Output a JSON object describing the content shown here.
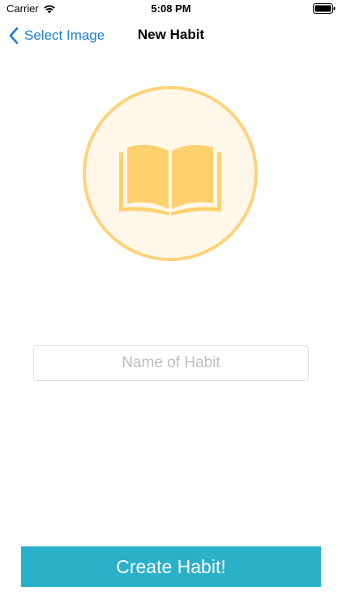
{
  "status_bar": {
    "carrier": "Carrier",
    "time": "5:08 PM",
    "icons": [
      "wifi-icon",
      "battery-icon"
    ]
  },
  "nav": {
    "back_label": "Select Image",
    "title": "New Habit",
    "back_icon": "chevron-left-icon"
  },
  "habit_image": {
    "icon": "book-icon",
    "ring_color": "#ffd27a",
    "fill_color": "#fff8ea",
    "icon_color": "#ffd06e"
  },
  "form": {
    "name_value": "",
    "name_placeholder": "Name of Habit"
  },
  "create_button": {
    "label": "Create Habit!",
    "color": "#2ab0c8"
  },
  "colors": {
    "accent": "#1a7fd1"
  }
}
